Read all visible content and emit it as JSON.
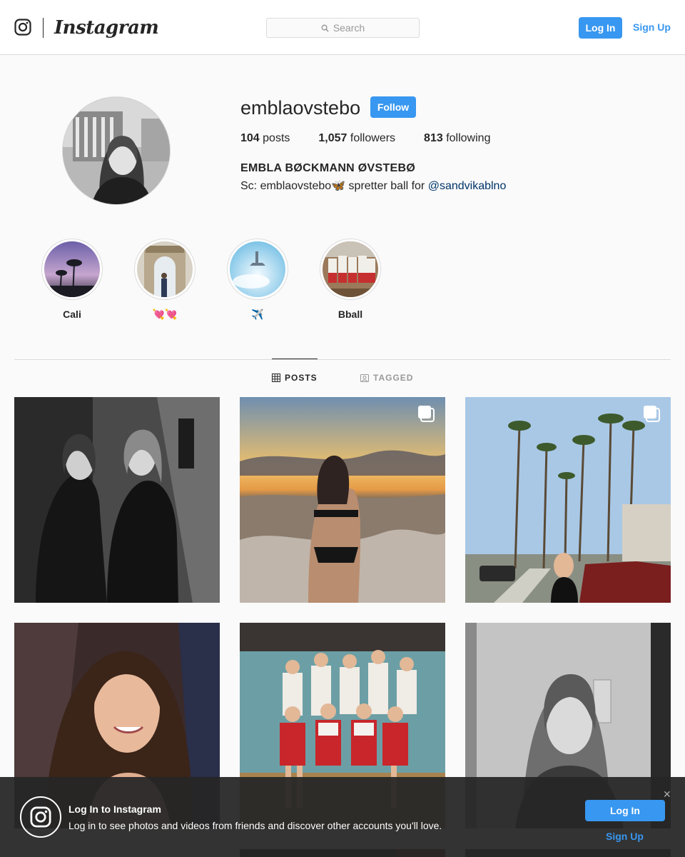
{
  "header": {
    "logo_glyph_icon": "instagram-glyph-icon",
    "wordmark": "Instagram",
    "search_placeholder": "Search",
    "login_label": "Log In",
    "signup_label": "Sign Up"
  },
  "profile": {
    "username": "emblaovstebo",
    "follow_label": "Follow",
    "posts_count": "104",
    "posts_label": "posts",
    "followers_count": "1,057",
    "followers_label": "followers",
    "following_count": "813",
    "following_label": "following",
    "full_name": "EMBLA BØCKMANN ØVSTEBØ",
    "bio_text": "Sc: emblaovstebo🦋 spretter ball for ",
    "bio_mention": "@sandvikablno"
  },
  "highlights": [
    {
      "label": "Cali"
    },
    {
      "label": "💘💘"
    },
    {
      "label": "✈️"
    },
    {
      "label": "Bball"
    }
  ],
  "tabs": {
    "posts_label": "POSTS",
    "tagged_label": "TAGGED"
  },
  "banner": {
    "title": "Log In to Instagram",
    "text": "Log in to see photos and videos from friends and discover other accounts you'll love.",
    "login_label": "Log In",
    "signup_label": "Sign Up",
    "close_label": "✕"
  },
  "colors": {
    "accent": "#3897f0",
    "mention": "#003569",
    "border": "#dbdbdb"
  }
}
